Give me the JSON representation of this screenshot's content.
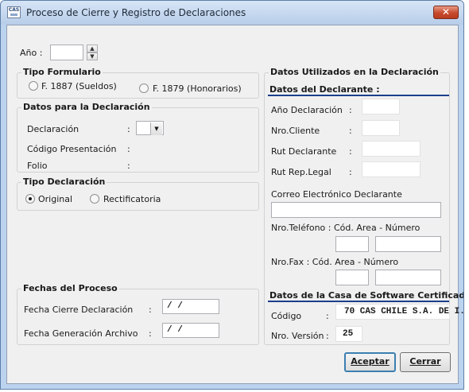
{
  "window": {
    "title": "Proceso de Cierre y Registro de Declaraciones",
    "close_glyph": "✕",
    "icon_text": "CAS"
  },
  "year": {
    "label": "Año :",
    "value": ""
  },
  "tipo_formulario": {
    "title": "Tipo Formulario",
    "opt1": "F. 1887 (Sueldos)",
    "opt2": "F. 1879 (Honorarios)"
  },
  "datos_declaracion": {
    "title": "Datos para la Declaración",
    "declaracion_label": "Declaración",
    "declaracion_colon": ":",
    "codigo_label": "Código Presentación",
    "codigo_colon": ":",
    "folio_label": "Folio",
    "folio_colon": ":"
  },
  "tipo_declaracion": {
    "title": "Tipo Declaración",
    "opt1": "Original",
    "opt2": "Rectificatoria",
    "selected": "Original"
  },
  "fechas": {
    "title": "Fechas del Proceso",
    "cierre_label": "Fecha Cierre Declaración",
    "cierre_colon": ":",
    "cierre_value": "/ /",
    "generacion_label": "Fecha Generación Archivo",
    "generacion_colon": ":",
    "generacion_value": "/ /"
  },
  "datos_utilizados": {
    "title": "Datos Utilizados en  la Declaración",
    "declarante_header": "Datos del Declarante :",
    "anio_label": "Año Declaración",
    "anio_colon": ":",
    "cliente_label": "Nro.Cliente",
    "cliente_colon": ":",
    "rut_label": "Rut Declarante",
    "rut_colon": ":",
    "rep_label": "Rut Rep.Legal",
    "rep_colon": ":",
    "correo_label": "Correo Electrónico Declarante",
    "telefono_label": "Nro.Teléfono : Cód. Area   - Número",
    "fax_label": "Nro.Fax       : Cód. Area  - Número",
    "software_header": "Datos de la Casa de Software Certificada:",
    "codigo_label": "Código",
    "codigo_colon": ":",
    "codigo_value": "70 CAS CHILE S.A. DE I.",
    "version_label": "Nro. Versión",
    "version_colon": ":",
    "version_value": "25"
  },
  "buttons": {
    "aceptar": "Aceptar",
    "cerrar": "Cerrar"
  },
  "colors": {
    "window_frame": "#bcd3ef",
    "client_bg": "#f0f0f0",
    "close_button": "#c74a2d",
    "section_underline": "#1c3f8c"
  }
}
